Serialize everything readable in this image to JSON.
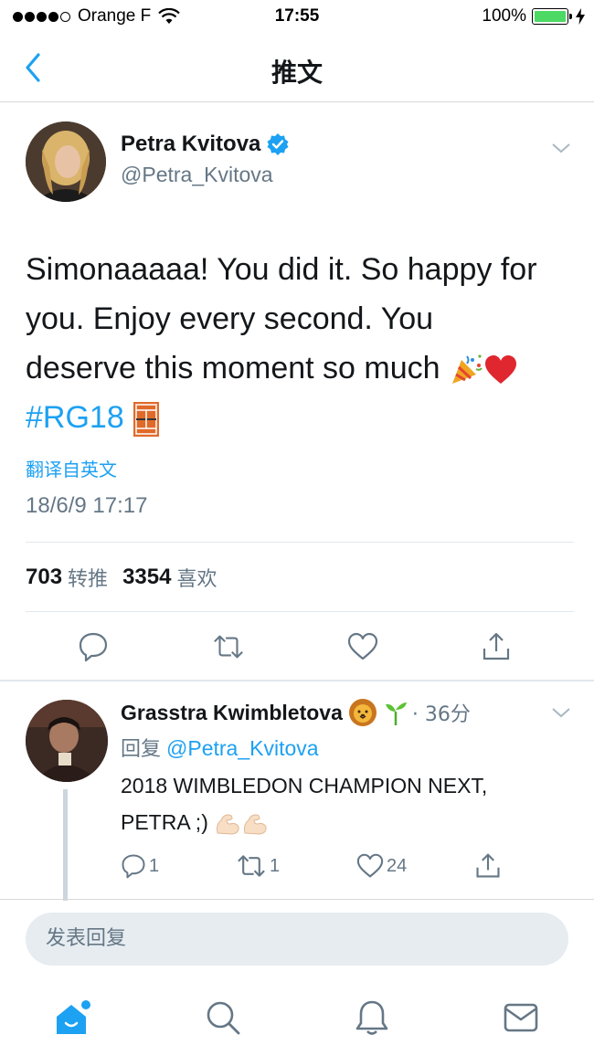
{
  "status_bar": {
    "carrier": "Orange F",
    "time": "17:55",
    "battery": "100%",
    "battery_level": 1.0
  },
  "nav": {
    "title": "推文",
    "back_icon": "chevron-left-icon"
  },
  "tweet": {
    "author_name": "Petra Kvitova",
    "author_handle": "@Petra_Kvitova",
    "verified": true,
    "text_line1": "Simonaaaaa! You did it. So happy for",
    "text_line2": "you. Enjoy every second. You",
    "text_line3": "deserve this moment so much",
    "hashtag": "#RG18",
    "translate_label": "翻译自英文",
    "timestamp": "18/6/9 17:17",
    "retweet_count": "703",
    "retweet_label": "转推",
    "like_count": "3354",
    "like_label": "喜欢"
  },
  "reply": {
    "author_name": "Grasstra Kwimbletova",
    "time": "· 36分",
    "reply_to_label": "回复",
    "reply_to_handle": "@Petra_Kvitova",
    "text_line1": "2018 WIMBLEDON CHAMPION NEXT,",
    "text_line2": "PETRA ;)",
    "reply_count": "1",
    "retweet_count": "1",
    "like_count": "24"
  },
  "compose": {
    "placeholder": "发表回复"
  },
  "tabs": [
    "home-icon",
    "search-icon",
    "bell-icon",
    "mail-icon"
  ],
  "colors": {
    "accent": "#1da1f2",
    "secondary_text": "#657786",
    "divider": "#e1e8ed",
    "battery": "#4cd964"
  }
}
